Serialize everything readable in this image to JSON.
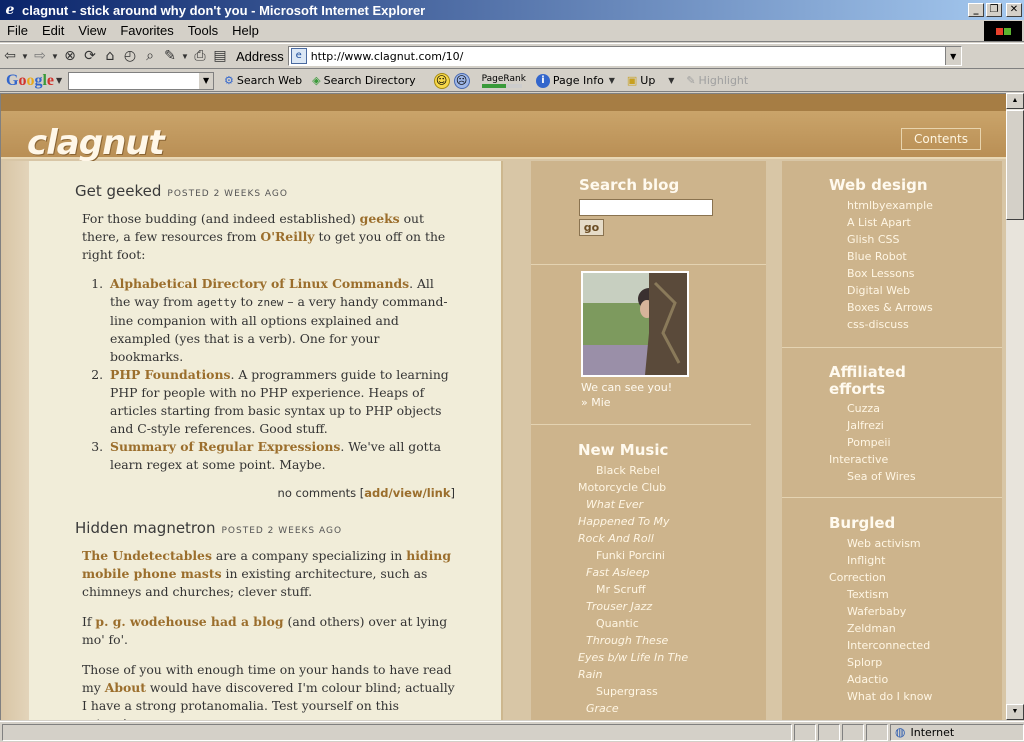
{
  "window": {
    "title": "clagnut - stick around why don't you - Microsoft Internet Explorer"
  },
  "menu": [
    "File",
    "Edit",
    "View",
    "Favorites",
    "Tools",
    "Help"
  ],
  "address": {
    "label": "Address",
    "url": "http://www.clagnut.com/10/"
  },
  "google_toolbar": {
    "logo": "Google",
    "search_web": "Search Web",
    "search_directory": "Search Directory",
    "pagerank_label": "PageRank",
    "pagerank_level": 0.6,
    "page_info": "Page Info",
    "up": "Up",
    "highlight": "Highlight"
  },
  "site": {
    "logo": "clagnut",
    "contents_label": "Contents"
  },
  "posts": [
    {
      "title": "Get geeked",
      "posted": "posted 2 weeks ago",
      "intro_pre": "For those budding (and indeed established) ",
      "intro_link1": "geeks",
      "intro_mid": " out there, a few resources from ",
      "intro_link2": "O'Reilly",
      "intro_post": " to get you off on the right foot:",
      "items": [
        {
          "link": "Alphabetical Directory of Linux Commands",
          "text_a": ". All the way from ",
          "code1": "agetty",
          "text_b": " to ",
          "code2": "znew",
          "text_c": " – a very handy command-line companion with all options explained and exampled (yes that is a verb). One for your bookmarks."
        },
        {
          "link": "PHP Foundations",
          "text": ". A programmers guide to learning PHP for people with no PHP experience. Heaps of articles starting from basic syntax up to PHP objects and C-style references. Good stuff."
        },
        {
          "link": "Summary of Regular Expressions",
          "text": ". We've all gotta learn regex at some point. Maybe."
        }
      ],
      "comments_pre": "no comments [",
      "comments_link": "add/view/link",
      "comments_post": "]"
    },
    {
      "title": "Hidden magnetron",
      "posted": "posted 2 weeks ago",
      "p1_link1": "The Undetectables",
      "p1_mid": " are a company specializing in ",
      "p1_link2": "hiding mobile phone masts",
      "p1_post": " in existing architecture, such as chimneys and churches; clever stuff.",
      "p2_pre": "If ",
      "p2_link": "p. g. wodehouse had a blog",
      "p2_post": " (and others) over at lying mo' fo'.",
      "p3_pre": "Those of you with enough time on your hands to have read my ",
      "p3_link": "About",
      "p3_post": " would have discovered I'm colour blind; actually I have a strong protanomalia. Test yourself on this extensive"
    }
  ],
  "sidebar_mid": {
    "search_heading": "Search blog",
    "go_label": "go",
    "photo_caption": "We can see you!",
    "photo_link": "» Mie",
    "music_heading": "New Music",
    "music": [
      {
        "text": "Black Rebel",
        "cls": "it"
      },
      {
        "text": "Motorcycle Club",
        "cls": "it cont"
      },
      {
        "text": "What Ever",
        "cls": "it i2 ital"
      },
      {
        "text": "Happened To My",
        "cls": "it cont ital"
      },
      {
        "text": "Rock And Roll",
        "cls": "it cont ital"
      },
      {
        "text": "Funki Porcini",
        "cls": "it"
      },
      {
        "text": "Fast Asleep",
        "cls": "it i2 ital"
      },
      {
        "text": "Mr Scruff",
        "cls": "it"
      },
      {
        "text": "Trouser Jazz",
        "cls": "it i2 ital"
      },
      {
        "text": "Quantic",
        "cls": "it"
      },
      {
        "text": "Through These",
        "cls": "it i2 ital"
      },
      {
        "text": "Eyes b/w Life In The",
        "cls": "it cont ital"
      },
      {
        "text": "Rain",
        "cls": "it cont ital"
      },
      {
        "text": "Supergrass",
        "cls": "it"
      },
      {
        "text": "Grace",
        "cls": "it i2 ital"
      }
    ]
  },
  "sidebar_right": {
    "web_design_heading": "Web design",
    "web_design": [
      "htmlbyexample",
      "A List Apart",
      "Glish CSS",
      "Blue Robot",
      "Box Lessons",
      "Digital Web",
      "Boxes & Arrows",
      "css-discuss"
    ],
    "affiliated_heading_1": "Affiliated",
    "affiliated_heading_2": "efforts",
    "affiliated": [
      {
        "text": "Cuzza",
        "cls": "it"
      },
      {
        "text": "Jalfrezi",
        "cls": "it"
      },
      {
        "text": "Pompeii",
        "cls": "it"
      },
      {
        "text": "Interactive",
        "cls": "it cont"
      },
      {
        "text": "Sea of Wires",
        "cls": "it"
      }
    ],
    "burgled_heading": "Burgled",
    "burgled": [
      {
        "text": "Web activism",
        "cls": "it"
      },
      {
        "text": "Inflight",
        "cls": "it"
      },
      {
        "text": "Correction",
        "cls": "it cont"
      },
      {
        "text": "Textism",
        "cls": "it"
      },
      {
        "text": "Waferbaby",
        "cls": "it"
      },
      {
        "text": "Zeldman",
        "cls": "it"
      },
      {
        "text": "Interconnected",
        "cls": "it"
      },
      {
        "text": "Splorp",
        "cls": "it"
      },
      {
        "text": "Adactio",
        "cls": "it"
      },
      {
        "text": "What do I know",
        "cls": "it"
      }
    ]
  },
  "status": {
    "zone": "Internet"
  }
}
